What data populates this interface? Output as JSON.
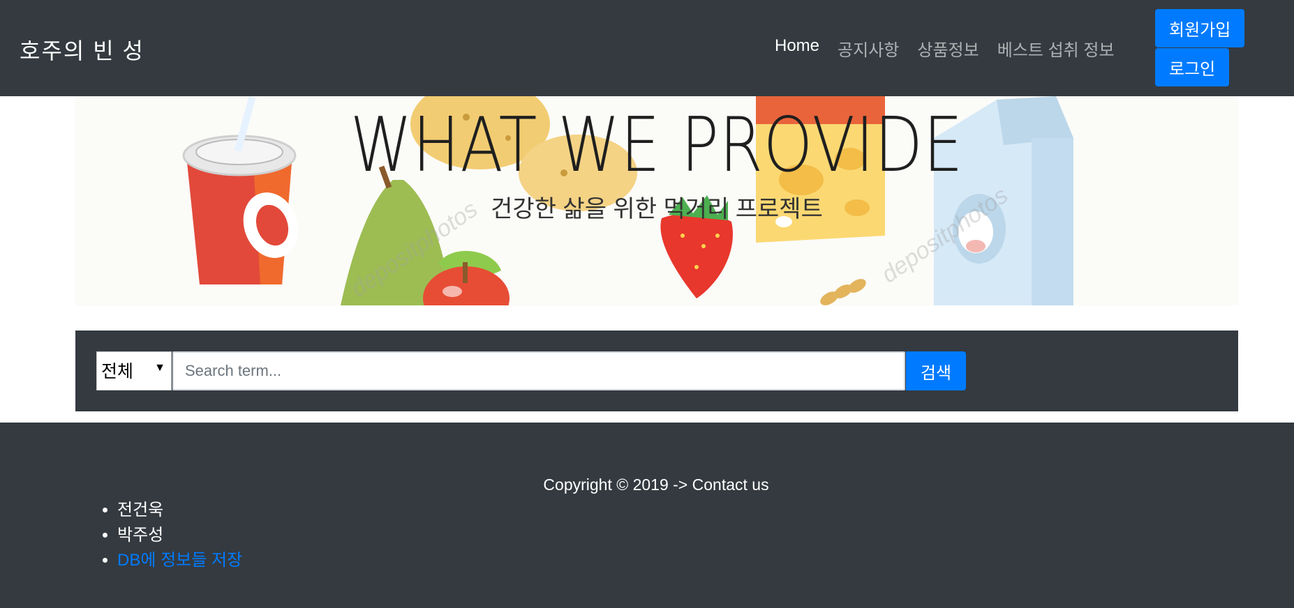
{
  "navbar": {
    "brand": "호주의 빈 성",
    "links": [
      "Home",
      "공지사항",
      "상품정보",
      "베스트 섭취 정보"
    ],
    "signup_label": "회원가입",
    "login_label": "로그인"
  },
  "hero": {
    "title": "WHAT WE PROVIDE",
    "subtitle": "건강한 삶을 위한 먹거리 프로젝트",
    "watermark": "depositphotos"
  },
  "search": {
    "category_selected": "전체",
    "placeholder": "Search term...",
    "button_label": "검색"
  },
  "footer": {
    "copyright": "Copyright © 2019 -> Contact us",
    "members": [
      "전건욱",
      "박주성"
    ],
    "link_label": "DB에 정보들 저장"
  },
  "colors": {
    "dark": "#343a40",
    "primary": "#007bff"
  }
}
